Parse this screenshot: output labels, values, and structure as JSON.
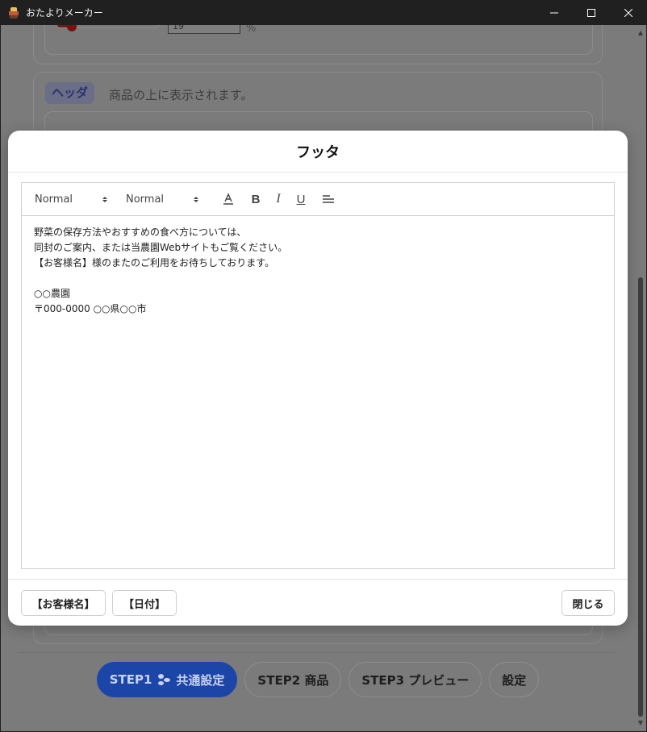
{
  "window": {
    "title": "おたよりメーカー"
  },
  "background": {
    "percent_value": "19",
    "percent_unit": "%",
    "header_chip": "ヘッダ",
    "header_description": "商品の上に表示されます。",
    "steps": [
      {
        "label": "STEP1",
        "sub": "共通設定",
        "active": true
      },
      {
        "label": "STEP2 商品",
        "active": false
      },
      {
        "label": "STEP3 プレビュー",
        "active": false
      },
      {
        "label": "設定",
        "active": false
      }
    ]
  },
  "modal": {
    "title": "フッタ",
    "toolbar": {
      "font_select": "Normal",
      "size_select": "Normal",
      "color_icon": "text-color-icon",
      "bold": "B",
      "italic": "I",
      "underline": "U",
      "align_icon": "align-left-icon"
    },
    "content_lines": [
      "野菜の保存方法やおすすめの食べ方については、",
      "同封のご案内、または当農園Webサイトもご覧ください。",
      "【お客様名】様のまたのご利用をお待ちしております。",
      "",
      "○○農園",
      "〒000-0000 ○○県○○市"
    ],
    "footer": {
      "customer_name_button": "【お客様名】",
      "date_button": "【日付】",
      "close_button": "閉じる"
    }
  },
  "colors": {
    "step_active": "#1c45a8",
    "header_chip_text": "#2c3170"
  }
}
